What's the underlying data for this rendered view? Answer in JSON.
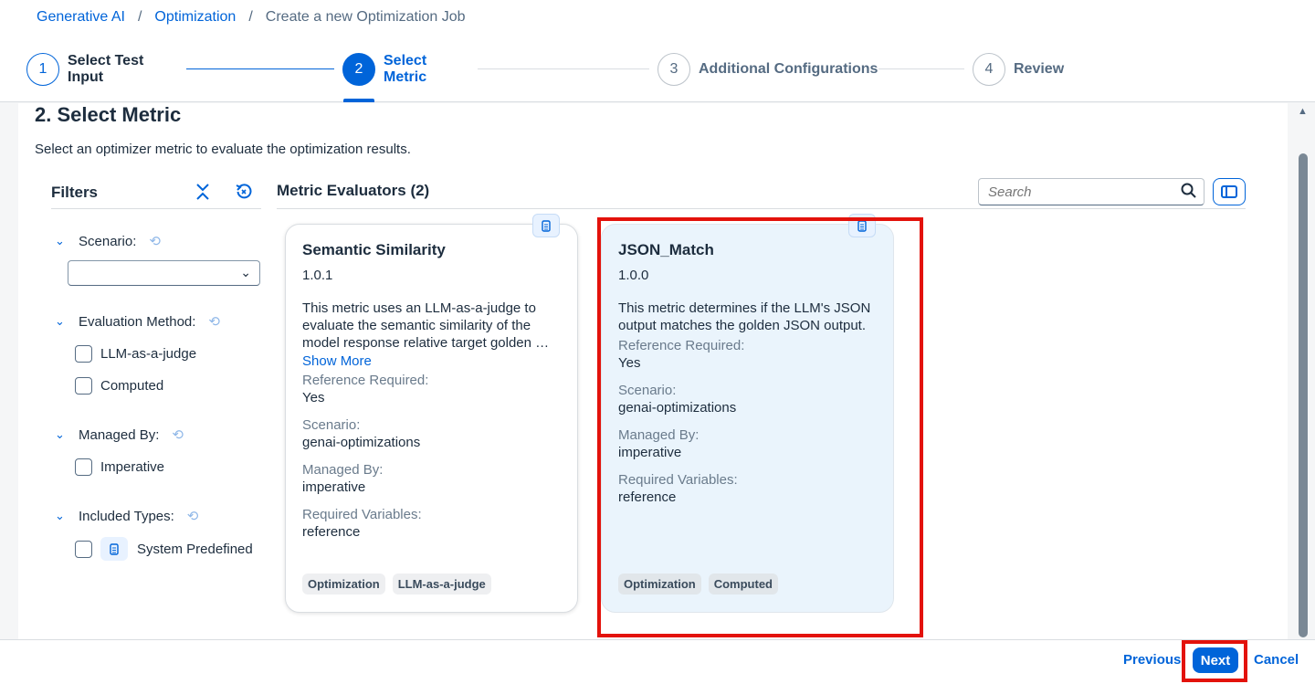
{
  "breadcrumb": {
    "items": [
      "Generative AI",
      "Optimization"
    ],
    "current": "Create a new Optimization Job",
    "separator": "/"
  },
  "stepper": {
    "steps": [
      {
        "number": "1",
        "label_line1": "Select Test",
        "label_line2": "Input",
        "state": "done"
      },
      {
        "number": "2",
        "label_line1": "Select",
        "label_line2": "Metric",
        "state": "active"
      },
      {
        "number": "3",
        "label": "Additional Configurations",
        "state": "pending"
      },
      {
        "number": "4",
        "label": "Review",
        "state": "pending"
      }
    ]
  },
  "section": {
    "title": "2. Select Metric",
    "description": "Select an optimizer metric to evaluate the optimization results."
  },
  "filters": {
    "title": "Filters",
    "groups": {
      "scenario": {
        "label": "Scenario:",
        "selected": ""
      },
      "evaluation_method": {
        "label": "Evaluation Method:",
        "options": [
          "LLM-as-a-judge",
          "Computed"
        ]
      },
      "managed_by": {
        "label": "Managed By:",
        "options": [
          "Imperative"
        ]
      },
      "included_types": {
        "label": "Included Types:",
        "options": [
          "System Predefined"
        ]
      }
    }
  },
  "evaluators": {
    "title": "Metric Evaluators (2)",
    "search_placeholder": "Search",
    "cards": [
      {
        "title": "Semantic Similarity",
        "version": "1.0.1",
        "description": "This metric uses an LLM-as-a-judge to evaluate the semantic similarity of the model response relative target golden …",
        "show_more": "Show More",
        "props": [
          {
            "label": "Reference Required:",
            "value": "Yes"
          },
          {
            "label": "Scenario:",
            "value": "genai-optimizations"
          },
          {
            "label": "Managed By:",
            "value": "imperative"
          },
          {
            "label": "Required Variables:",
            "value": "reference"
          }
        ],
        "tags": [
          "Optimization",
          "LLM-as-a-judge"
        ]
      },
      {
        "title": "JSON_Match",
        "version": "1.0.0",
        "description": "This metric determines if the LLM's JSON output matches the golden JSON output.",
        "props": [
          {
            "label": "Reference Required:",
            "value": "Yes"
          },
          {
            "label": "Scenario:",
            "value": "genai-optimizations"
          },
          {
            "label": "Managed By:",
            "value": "imperative"
          },
          {
            "label": "Required Variables:",
            "value": "reference"
          }
        ],
        "tags": [
          "Optimization",
          "Computed"
        ]
      }
    ]
  },
  "footer": {
    "previous": "Previous",
    "next": "Next",
    "cancel": "Cancel"
  },
  "colors": {
    "accent": "#0064d9",
    "highlight": "#e3120b",
    "selected_card_bg": "#eaf4fc"
  },
  "icons": [
    "clear-filters-icon",
    "reset-icon",
    "chevron-down-icon",
    "search-icon",
    "side-panel-icon",
    "document-icon",
    "scroll-up-icon"
  ]
}
